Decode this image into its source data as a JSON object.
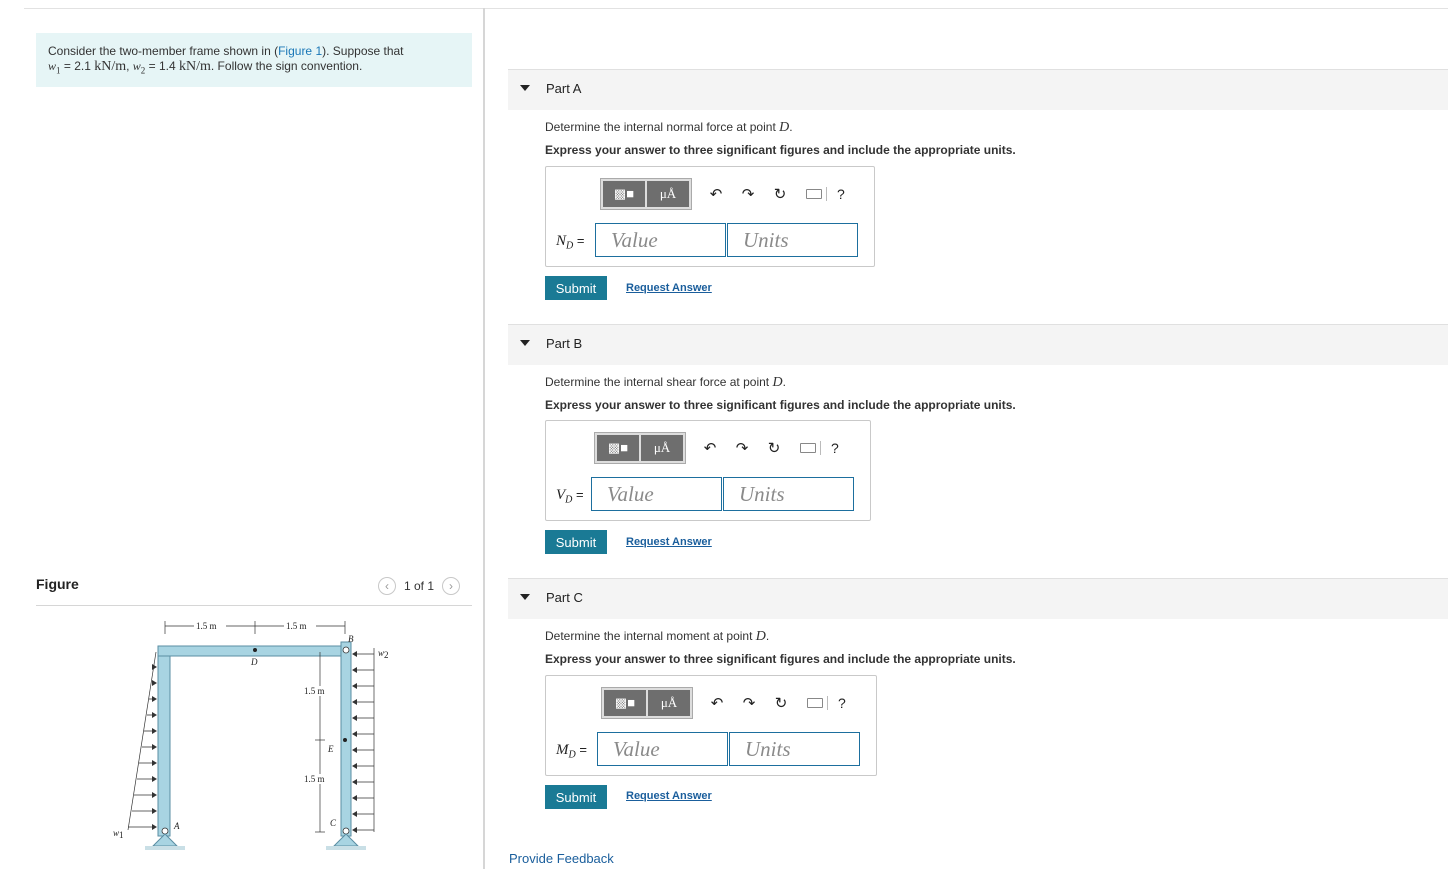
{
  "problem": {
    "intro": "Consider the two-member frame shown in (",
    "figure_link": "Figure 1",
    "intro_end": "). Suppose that",
    "w1_sym": "w",
    "w1_sub": "1",
    "w1_eq": " = 2.1 ",
    "w1_unit": "kN/m",
    "comma": ", ",
    "w2_sym": "w",
    "w2_sub": "2",
    "w2_eq": " = 1.4 ",
    "w2_unit": "kN/m",
    "follow": ". Follow the sign convention."
  },
  "figure_panel": {
    "header": "Figure",
    "pager": "1 of 1",
    "prev_icon": "chevron-left-icon",
    "next_icon": "chevron-right-icon",
    "labels": {
      "dim_left": "1.5 m",
      "dim_right": "1.5 m",
      "point_B": "B",
      "point_D": "D",
      "w2": "w",
      "w2_sub": "2",
      "dim_upper": "1.5 m",
      "point_E": "E",
      "dim_lower": "1.5 m",
      "point_C": "C",
      "point_A": "A",
      "w1": "w",
      "w1_sub": "1"
    }
  },
  "parts": [
    {
      "title": "Part A",
      "question_pre": "Determine the internal normal force at point ",
      "question_var": "D",
      "question_post": ".",
      "instruction": "Express your answer to three significant figures and include the appropriate units.",
      "var_sym": "N",
      "var_sub": "D",
      "value_placeholder": "Value",
      "units_placeholder": "Units",
      "submit": "Submit",
      "request": "Request Answer"
    },
    {
      "title": "Part B",
      "question_pre": "Determine the internal shear force at point ",
      "question_var": "D",
      "question_post": ".",
      "instruction": "Express your answer to three significant figures and include the appropriate units.",
      "var_sym": "V",
      "var_sub": "D",
      "value_placeholder": "Value",
      "units_placeholder": "Units",
      "submit": "Submit",
      "request": "Request Answer"
    },
    {
      "title": "Part C",
      "question_pre": "Determine the internal moment at point ",
      "question_var": "D",
      "question_post": ".",
      "instruction": "Express your answer to three significant figures and include the appropriate units.",
      "var_sym": "M",
      "var_sub": "D",
      "value_placeholder": "Value",
      "units_placeholder": "Units",
      "submit": "Submit",
      "request": "Request Answer"
    }
  ],
  "toolbar": {
    "mu_label": "μÅ",
    "help": "?",
    "icons": [
      "templates-icon",
      "units-icon",
      "undo-icon",
      "redo-icon",
      "reset-icon",
      "keyboard-icon",
      "help-icon"
    ]
  },
  "eq": " =",
  "feedback": "Provide Feedback",
  "colors": {
    "accent": "#1a7a95",
    "link": "#1a5e9c",
    "problem_bg": "#e6f5f6",
    "frame": "#a8d4e2"
  }
}
